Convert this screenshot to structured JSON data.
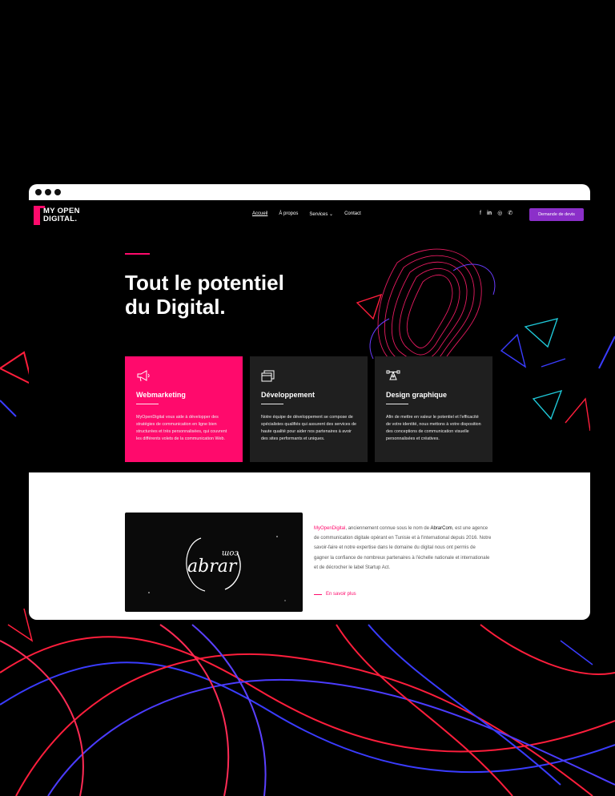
{
  "header": {
    "logo_line1": "MY OPEN",
    "logo_line2": "DIGITAL.",
    "nav": [
      "Accueil",
      "À propos",
      "Services",
      "Contact"
    ],
    "services_caret": "⌄",
    "socials": [
      "f",
      "in",
      "◎",
      "✆"
    ],
    "cta": "Demande de devis"
  },
  "hero": {
    "title_line1": "Tout le potentiel",
    "title_line2": "du Digital."
  },
  "cards": [
    {
      "title": "Webmarketing",
      "icon": "megaphone-icon",
      "text": "MyOpenDigital vous aide à développer des stratégies de communication en ligne bien structurées et très personnalisées, qui couvrent les différents volets de la communication Web."
    },
    {
      "title": "Développement",
      "icon": "browser-windows-icon",
      "text": "Notre équipe de développement se compose de spécialistes qualifiés qui assurent des services de haute qualité pour aider nos partenaires à avoir des sites performants et uniques."
    },
    {
      "title": "Design graphique",
      "icon": "bezier-pen-icon",
      "text": "Afin de mettre en valeur le potentiel et l'efficacité de votre identité, nous mettons à votre disposition des conceptions de communication visuelle personnalisées et créatives."
    }
  ],
  "about": {
    "video_logo_main": "abrar",
    "video_logo_small": "com",
    "brand": "MyOpenDigital",
    "text_part1": ", anciennement connue sous le nom de ",
    "old_brand": "AbrarCom",
    "text_part2": ", est une agence de communication digitale opérant en Tunisie et à l'international depuis 2016. Notre savoir-faire et notre expertise dans le domaine du digital nous ont permis de gagner la confiance de nombreux partenaires à l'échelle nationale et internationale et de décrocher le label Startup Act.",
    "more": "En savoir plus"
  },
  "colors": {
    "accent": "#ff0a6c",
    "cta": "#8b2fc9",
    "card_dark": "#1f1f1f"
  }
}
